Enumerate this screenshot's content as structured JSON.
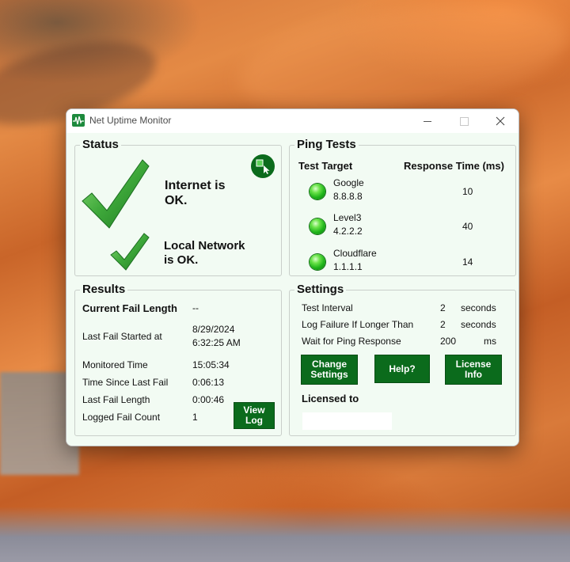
{
  "window": {
    "title": "Net Uptime Monitor",
    "controls": {
      "minimize": "—",
      "maximize": "☐",
      "close": "✕"
    }
  },
  "status": {
    "heading": "Status",
    "internet_line1": "Internet is",
    "internet_line2": "OK.",
    "local_line1": "Local Network",
    "local_line2": "is OK.",
    "internet_state": "ok",
    "local_state": "ok"
  },
  "ping": {
    "heading": "Ping Tests",
    "col_target": "Test Target",
    "col_response": "Response Time (ms)",
    "rows": [
      {
        "name": "Google",
        "ip": "8.8.8.8",
        "time": "10",
        "state": "ok"
      },
      {
        "name": "Level3",
        "ip": "4.2.2.2",
        "time": "40",
        "state": "ok"
      },
      {
        "name": "Cloudflare",
        "ip": "1.1.1.1",
        "time": "14",
        "state": "ok"
      }
    ]
  },
  "results": {
    "heading": "Results",
    "current_fail_label": "Current Fail Length",
    "current_fail_value": "--",
    "last_fail_started_label": "Last Fail Started at",
    "last_fail_started_date": "8/29/2024",
    "last_fail_started_time": "6:32:25 AM",
    "monitored_label": "Monitored Time",
    "monitored_value": "15:05:34",
    "since_label": "Time Since Last Fail",
    "since_value": "0:06:13",
    "length_label": "Last Fail Length",
    "length_value": "0:00:46",
    "count_label": "Logged Fail Count",
    "count_value": "1",
    "view_log_line1": "View",
    "view_log_line2": "Log"
  },
  "settings": {
    "heading": "Settings",
    "rows": [
      {
        "label": "Test Interval",
        "value": "2",
        "unit": "seconds"
      },
      {
        "label": "Log Failure If Longer Than",
        "value": "2",
        "unit": "seconds"
      },
      {
        "label": "Wait for Ping Response",
        "value": "200",
        "unit": "ms"
      }
    ],
    "change_line1": "Change",
    "change_line2": "Settings",
    "help": "Help?",
    "license_line1": "License",
    "license_line2": "Info",
    "licensed_to_label": "Licensed to",
    "licensed_to_value": ""
  },
  "colors": {
    "accent_green": "#0b6b1c",
    "panel_bg": "#f2fbf3",
    "led_green": "#1fb41a"
  },
  "icons": [
    "app-monitor-icon",
    "mini-mode-icon",
    "big-checkmark-icon",
    "small-checkmark-icon",
    "status-led-icon"
  ]
}
